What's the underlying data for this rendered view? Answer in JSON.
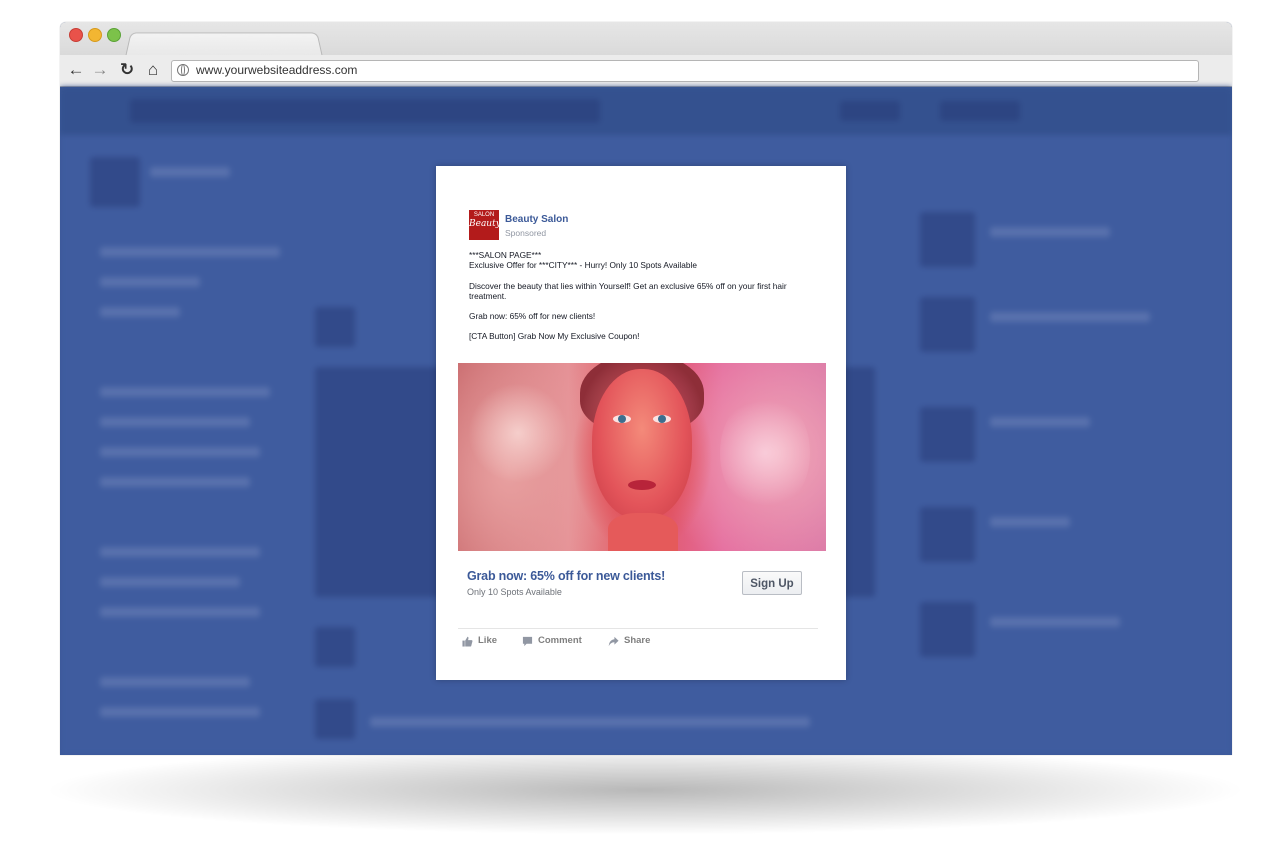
{
  "browser": {
    "url": "www.yourwebsiteaddress.com"
  },
  "ad": {
    "page_name": "Beauty Salon",
    "sponsored_label": "Sponsored",
    "logo": {
      "top_text": "SALON",
      "brand": "Beauty",
      "color": "#b31b1b"
    },
    "body": {
      "line1": "***SALON PAGE***",
      "line2": "Exclusive Offer for ***CITY*** - Hurry! Only 10 Spots Available",
      "para2": "Discover the beauty that lies within Yourself! Get an exclusive 65% off on your first hair treatment.",
      "para3": "Grab now: 65% off for new clients!",
      "para4": "[CTA Button] Grab Now My Exclusive Coupon!"
    },
    "cta": {
      "headline": "Grab now: 65% off for new clients!",
      "description": "Only 10 Spots Available",
      "button_label": "Sign Up"
    },
    "actions": [
      {
        "label": "Like",
        "icon": "thumbs-up-icon"
      },
      {
        "label": "Comment",
        "icon": "comment-icon"
      },
      {
        "label": "Share",
        "icon": "share-arrow-icon"
      }
    ]
  },
  "colors": {
    "facebook_blue": "#3b5998",
    "link_blue": "#3b5998"
  }
}
